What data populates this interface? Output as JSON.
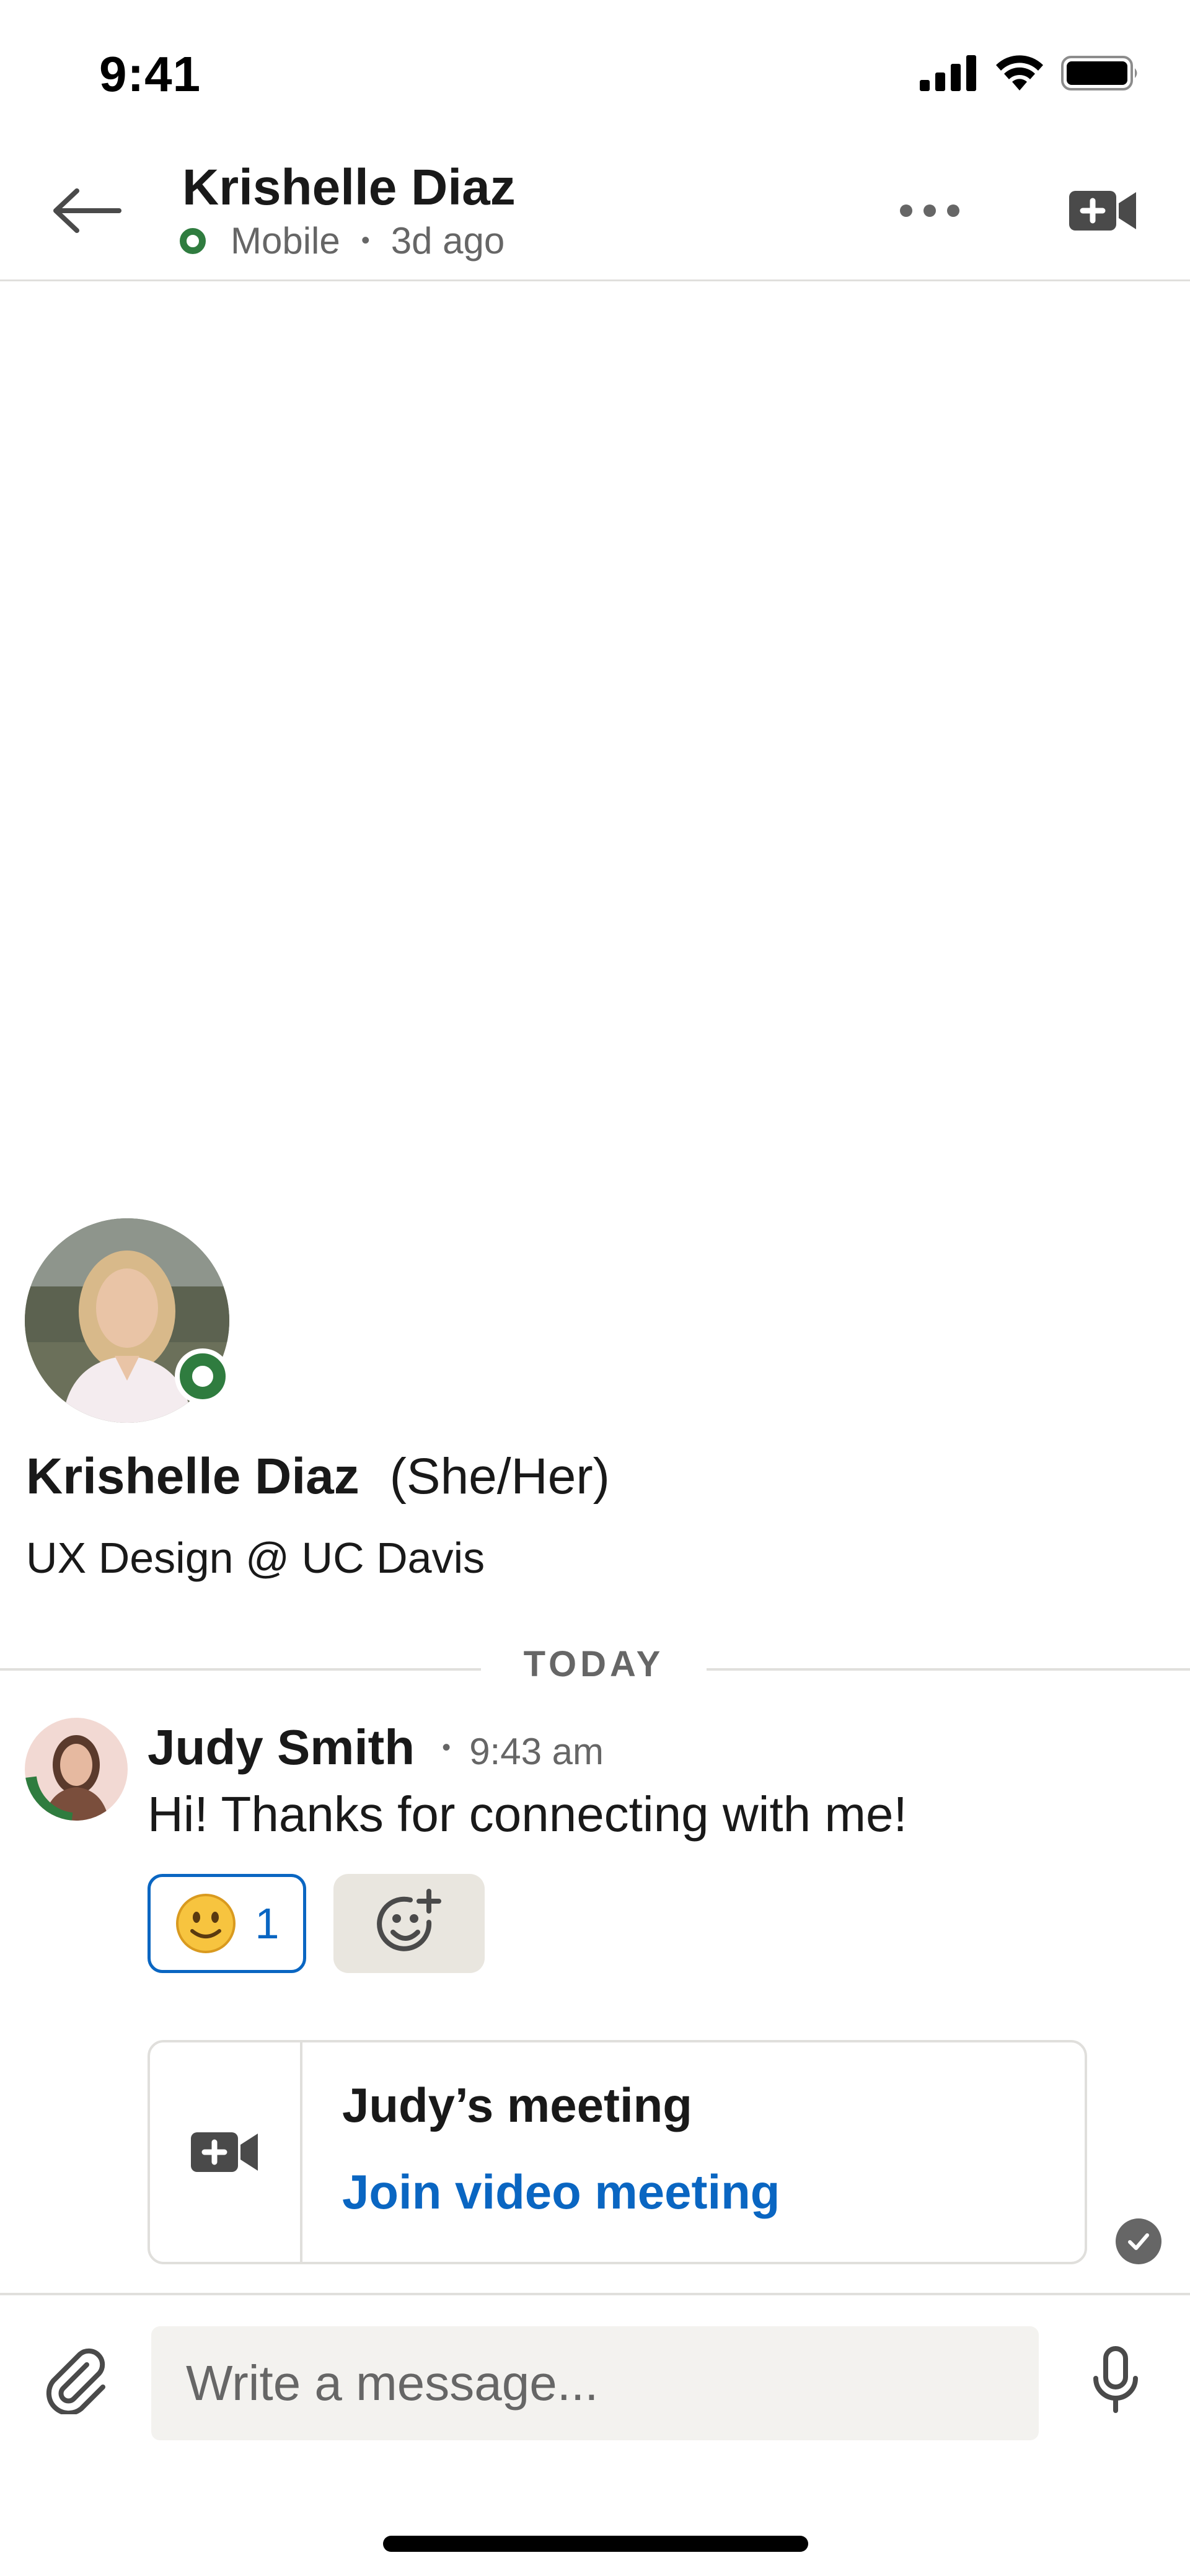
{
  "status_bar": {
    "time": "9:41",
    "icons": [
      "cellular-signal-icon",
      "wifi-icon",
      "battery-icon"
    ]
  },
  "header": {
    "contact_name": "Krishelle Diaz",
    "presence": "Mobile",
    "last_seen": "3d ago",
    "icons": {
      "back": "arrow-left-icon",
      "more": "more-options-icon",
      "video": "video-call-icon"
    }
  },
  "profile": {
    "name": "Krishelle Diaz",
    "pronouns": "(She/Her)",
    "headline": "UX Design @ UC Davis"
  },
  "conversation": {
    "date_divider": "TODAY",
    "messages": [
      {
        "sender": "Judy Smith",
        "time": "9:43 am",
        "text": "Hi! Thanks for connecting with me!",
        "reactions": [
          {
            "emoji": "🙂",
            "count": "1"
          }
        ],
        "meeting": {
          "title": "Judy’s meeting",
          "link_label": "Join video meeting"
        }
      }
    ]
  },
  "composer": {
    "placeholder": "Write a message...",
    "value": ""
  },
  "colors": {
    "accent": "#0a66c2",
    "online": "#2f7c3f",
    "text_primary": "#191919",
    "text_secondary": "#666666",
    "divider": "#e0dfdc"
  }
}
